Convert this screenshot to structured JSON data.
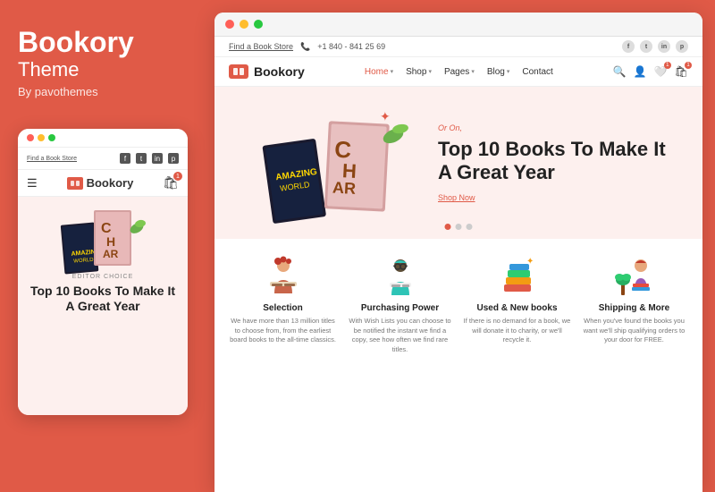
{
  "left": {
    "brand": "Bookory",
    "subtitle": "Theme",
    "by": "By pavothemes",
    "mobile": {
      "dots": [
        "#ff5f57",
        "#ffbd2e",
        "#28c840"
      ],
      "link": "Find a Book Store",
      "logo": "Bookory",
      "editor_label": "EDITOR CHOICE",
      "hero_title": "Top 10 Books To Make It A Great Year",
      "cart_count": "1"
    }
  },
  "browser": {
    "topbar": {
      "link": "Find a Book Store",
      "phone": "+1 840 - 841 25 69",
      "socials": [
        "f",
        "t",
        "in",
        "p"
      ]
    },
    "navbar": {
      "logo": "Bookory",
      "links": [
        {
          "label": "Home",
          "has_dropdown": true,
          "active": true
        },
        {
          "label": "Shop",
          "has_dropdown": true,
          "active": false
        },
        {
          "label": "Pages",
          "has_dropdown": true,
          "active": false
        },
        {
          "label": "Blog",
          "has_dropdown": true,
          "active": false
        },
        {
          "label": "Contact",
          "has_dropdown": false,
          "active": false
        }
      ]
    },
    "hero": {
      "title": "Top 10 Books To Make It A Great Year",
      "label": "Or On",
      "cta": "Shop Now",
      "dots": [
        "active",
        "",
        ""
      ]
    },
    "features": [
      {
        "title": "Selection",
        "desc": "We have more than 13 million titles to choose from, from the earliest board books to the all-time classics.",
        "icon": "reader-icon"
      },
      {
        "title": "Purchasing Power",
        "desc": "With Wish Lists you can choose to be notified the instant we find a copy, see how often we find rare titles.",
        "icon": "glasses-reader-icon"
      },
      {
        "title": "Used & New books",
        "desc": "If there is no demand for a book, we will donate it to charity, or we'll recycle it.",
        "icon": "book-stack-icon"
      },
      {
        "title": "Shipping & More",
        "desc": "When you've found the books you want we'll ship qualifying orders to your door for FREE.",
        "icon": "person-books-icon"
      }
    ]
  }
}
